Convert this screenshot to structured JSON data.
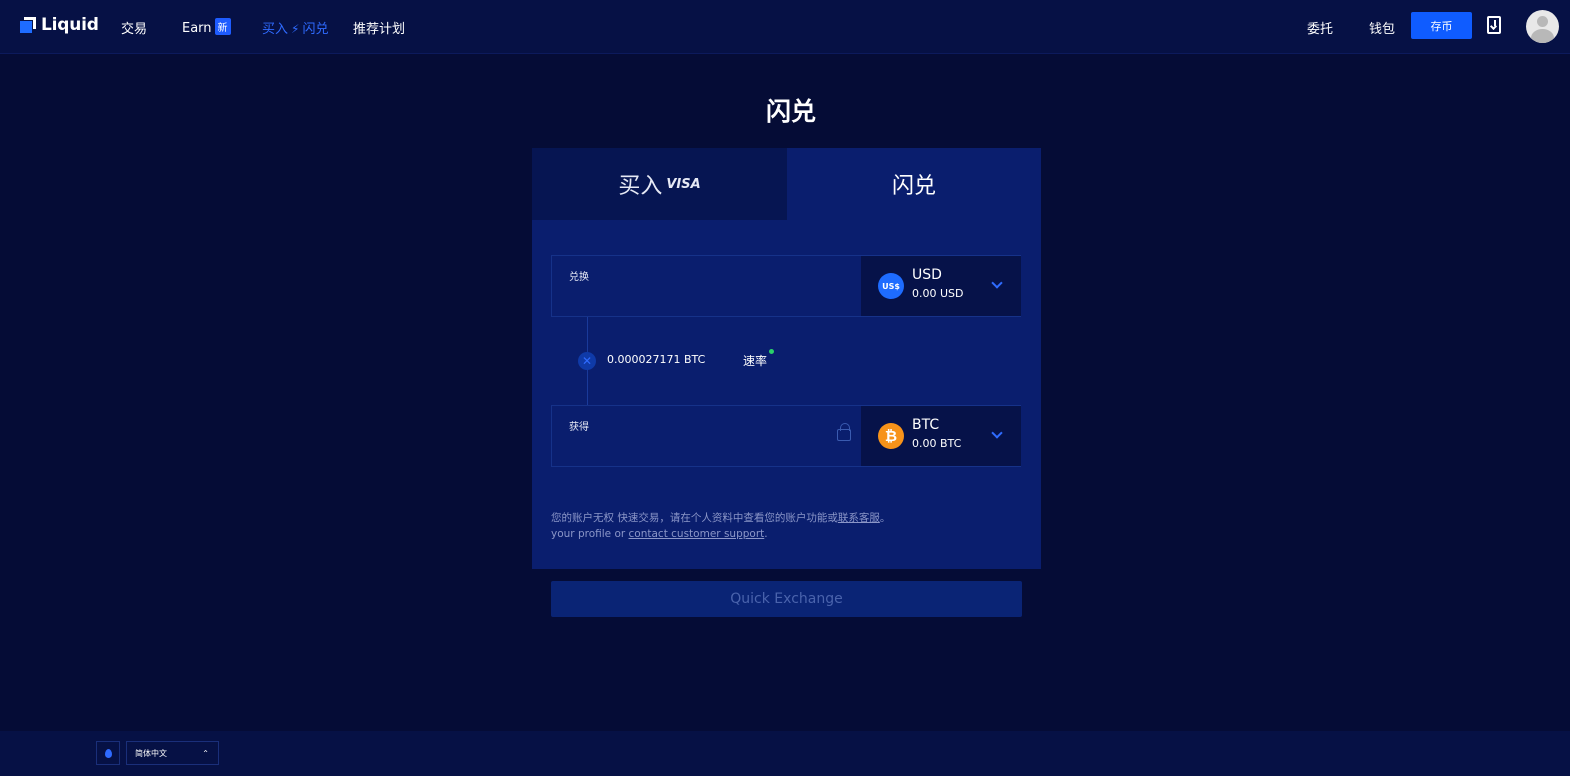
{
  "header": {
    "logo_text": "Liquid",
    "nav": {
      "trade": "交易",
      "earn": "Earn",
      "earn_badge": "新",
      "buy": "买入",
      "swap": "闪兑",
      "referral": "推荐计划"
    },
    "delegate": "委托",
    "wallet": "钱包",
    "deposit_button": "存币",
    "icons": [
      "download-app-icon",
      "avatar"
    ]
  },
  "page": {
    "title": "闪兑"
  },
  "card": {
    "tabs": [
      {
        "label": "买入",
        "tag": "VISA"
      },
      {
        "label": "闪兑"
      }
    ],
    "from_field": {
      "label": "兑换",
      "value": "",
      "currency": "USD",
      "coin_label": "US$",
      "balance": "0.00 USD"
    },
    "rate": {
      "value": "0.000027171 BTC",
      "label": "速率"
    },
    "to_field": {
      "label": "获得",
      "value": "",
      "currency": "BTC",
      "coin_label": "₿",
      "balance": "0.00 BTC"
    },
    "notice": {
      "line1_text": "您的账户无权 快速交易，请在个人资料中查看您的账户功能或",
      "line1_link": "联系客服",
      "line1_end": "。",
      "line2_text": "your profile or ",
      "line2_link": "contact customer support",
      "line2_end": "."
    }
  },
  "action": {
    "quick_exchange": "Quick Exchange"
  },
  "footer": {
    "language": "简体中文",
    "caret": "⌃"
  },
  "colors": {
    "background": "#050c36",
    "header": "#061145",
    "card": "#0a1e6e",
    "accent": "#0f5cff",
    "btc": "#f7931a",
    "live": "#2ad06a"
  }
}
